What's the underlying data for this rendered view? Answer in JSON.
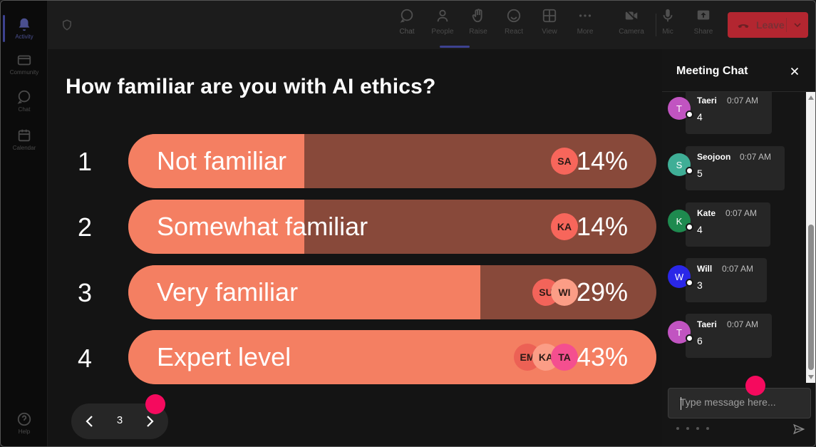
{
  "rail": {
    "items": [
      {
        "label": "Activity",
        "icon": "bell-icon",
        "active": true
      },
      {
        "label": "Community",
        "icon": "community-icon"
      },
      {
        "label": "Chat",
        "icon": "chat-bubble-icon"
      },
      {
        "label": "Calendar",
        "icon": "calendar-icon"
      }
    ],
    "help_label": "Help"
  },
  "toolbar": {
    "chat": "Chat",
    "people": "People",
    "raise": "Raise",
    "react": "React",
    "view": "View",
    "more": "More",
    "camera": "Camera",
    "mic": "Mic",
    "share": "Share",
    "leave": "Leave"
  },
  "poll": {
    "question": "How familiar are you with AI ethics?",
    "options": [
      {
        "num": "1",
        "label": "Not familiar",
        "pct": "14%",
        "fill": 0.333,
        "avatars": [
          {
            "text": "SA",
            "color": "#f7665b"
          }
        ]
      },
      {
        "num": "2",
        "label": "Somewhat familiar",
        "pct": "14%",
        "fill": 0.333,
        "avatars": [
          {
            "text": "KA",
            "color": "#f7665b"
          }
        ]
      },
      {
        "num": "3",
        "label": "Very familiar",
        "pct": "29%",
        "fill": 0.666,
        "avatars": [
          {
            "text": "SU",
            "color": "#f2645a"
          },
          {
            "text": "WI",
            "color": "#fb9d86"
          }
        ]
      },
      {
        "num": "4",
        "label": "Expert level",
        "pct": "43%",
        "fill": 1.0,
        "avatars": [
          {
            "text": "EM",
            "color": "#ec6155"
          },
          {
            "text": "KA",
            "color": "#fb9d86"
          },
          {
            "text": "TA",
            "color": "#f44f8f"
          }
        ]
      }
    ],
    "page": "3"
  },
  "colors": {
    "bar_fill": "#f47f62",
    "bar_track": "#88493a",
    "pink_marker": "#f50a5e",
    "leave": "#b32630"
  },
  "chat": {
    "title": "Meeting Chat",
    "messages": [
      {
        "initial": "T",
        "name": "Taeri",
        "time": "0:07 AM",
        "body": "4",
        "color": "#c154c1"
      },
      {
        "initial": "S",
        "name": "Seojoon",
        "time": "0:07 AM",
        "body": "5",
        "color": "#3fae96"
      },
      {
        "initial": "K",
        "name": "Kate",
        "time": "0:07 AM",
        "body": "4",
        "color": "#1e8a4f"
      },
      {
        "initial": "W",
        "name": "Will",
        "time": "0:07 AM",
        "body": "3",
        "color": "#2a27e8"
      },
      {
        "initial": "T",
        "name": "Taeri",
        "time": "0:07 AM",
        "body": "6",
        "color": "#c154c1"
      }
    ],
    "placeholder": "Type message here..."
  }
}
